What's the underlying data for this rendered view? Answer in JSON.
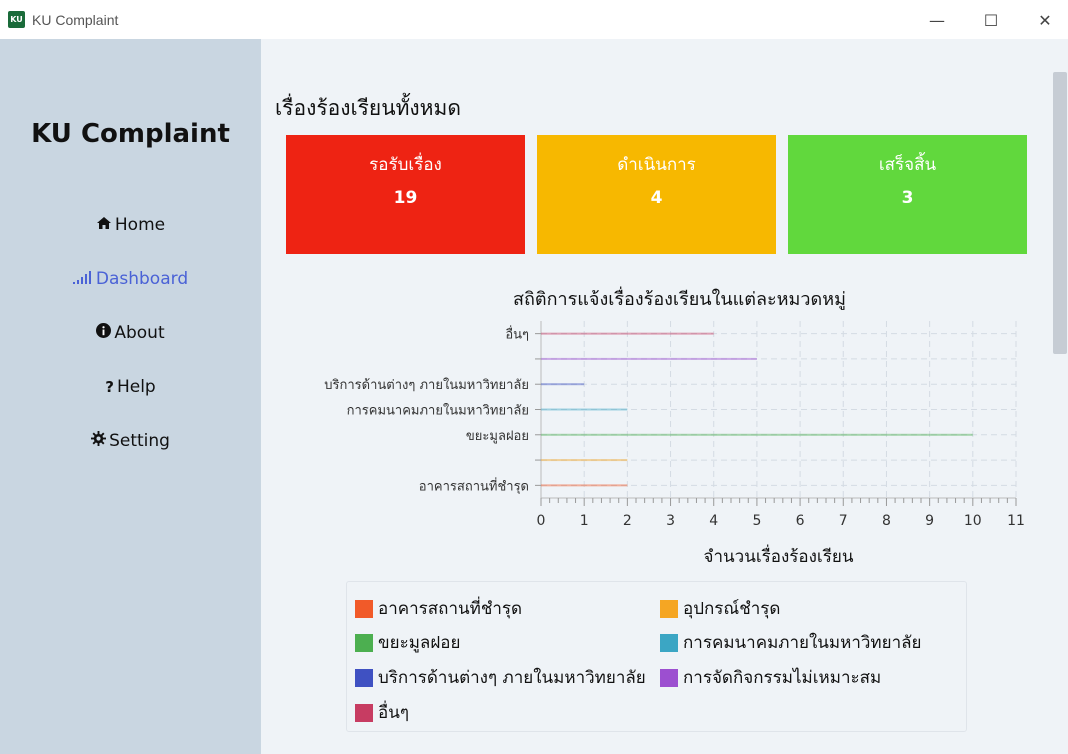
{
  "window": {
    "logo_text": "KU",
    "title": "KU Complaint",
    "minimize": "—",
    "maximize": "☐",
    "close": "✕"
  },
  "sidebar": {
    "brand": "KU Complaint",
    "items": [
      {
        "label": "Home",
        "icon": "home-icon",
        "glyph": "🏠︎"
      },
      {
        "label": "Dashboard",
        "icon": "bar-signal-icon",
        "glyph": "▁▂▃",
        "active": true
      },
      {
        "label": "About",
        "icon": "info-icon",
        "glyph": "ℹ"
      },
      {
        "label": "Help",
        "icon": "question-icon",
        "glyph": "?"
      },
      {
        "label": "Setting",
        "icon": "gear-icon",
        "glyph": "⚙"
      }
    ]
  },
  "main": {
    "title": "เรื่องร้องเรียนทั้งหมด",
    "cards": [
      {
        "label": "รอรับเรื่อง",
        "value": "19",
        "color": "#ee2313"
      },
      {
        "label": "ดำเนินการ",
        "value": "4",
        "color": "#f7b800"
      },
      {
        "label": "เสร็จสิ้น",
        "value": "3",
        "color": "#61d83d"
      }
    ]
  },
  "chart_data": {
    "type": "bar",
    "orientation": "horizontal",
    "title": "สถิติการแจ้งเรื่องร้องเรียนในแต่ละหมวดหมู่",
    "xlabel": "จำนวนเรื่องร้องเรียน",
    "xlim": [
      0,
      11
    ],
    "xticks": [
      "0",
      "1",
      "2",
      "3",
      "4",
      "5",
      "6",
      "7",
      "8",
      "9",
      "10",
      "11"
    ],
    "grid": true,
    "legend_position": "bottom",
    "categories": [
      "อาคารสถานที่ชำรุด",
      "อุปกรณ์ชำรุด",
      "ขยะมูลฝอย",
      "การคมนาคมภายในมหาวิทยาลัย",
      "บริการด้านต่างๆ ภายในมหาวิทยาลัย",
      "การจัดกิจกรรมไม่เหมาะสม",
      "อื่นๆ"
    ],
    "shown_tick_labels": [
      "อาคารสถานที่ชำรุด",
      "",
      "ขยะมูลฝอย",
      "การคมนาคมภายในมหาวิทยาลัย",
      "บริการด้านต่างๆ ภายในมหาวิทยาลัย",
      "",
      "อื่นๆ"
    ],
    "values": [
      2,
      2,
      10,
      2,
      1,
      5,
      4
    ],
    "colors": [
      "#f15a29",
      "#f5a623",
      "#4caf50",
      "#3ba6c4",
      "#3f51c2",
      "#9c4fd0",
      "#c73c62"
    ]
  },
  "legend": {
    "items": [
      {
        "label": "อาคารสถานที่ชำรุด",
        "color": "#f15a29"
      },
      {
        "label": "อุปกรณ์ชำรุด",
        "color": "#f5a623"
      },
      {
        "label": "ขยะมูลฝอย",
        "color": "#4caf50"
      },
      {
        "label": "การคมนาคมภายในมหาวิทยาลัย",
        "color": "#3ba6c4"
      },
      {
        "label": "บริการด้านต่างๆ ภายในมหาวิทยาลัย",
        "color": "#3f51c2"
      },
      {
        "label": "การจัดกิจกรรมไม่เหมาะสม",
        "color": "#9c4fd0"
      },
      {
        "label": "อื่นๆ",
        "color": "#c73c62"
      }
    ]
  }
}
